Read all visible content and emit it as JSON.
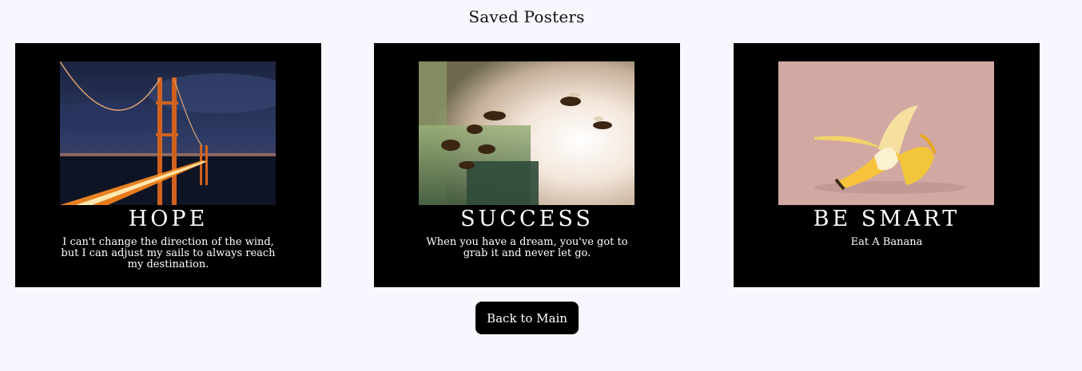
{
  "page": {
    "title": "Saved Posters"
  },
  "posters": [
    {
      "title": "HOPE",
      "quote": "I can't change the direction of the wind, but I can adjust my sails to always reach my destination.",
      "image": "golden-gate-bridge-night-photo"
    },
    {
      "title": "SUCCESS",
      "quote": "When you have a dream, you've got to grab it and never let go.",
      "image": "bees-at-hive-photo"
    },
    {
      "title": "BE SMART",
      "quote": "Eat A Banana",
      "image": "peeled-banana-photo"
    }
  ],
  "actions": {
    "back_label": "Back to Main"
  },
  "colors": {
    "background": "#f7f7ff",
    "poster_background": "#000000",
    "button_background": "#000000",
    "text_on_dark": "#ffffff"
  }
}
